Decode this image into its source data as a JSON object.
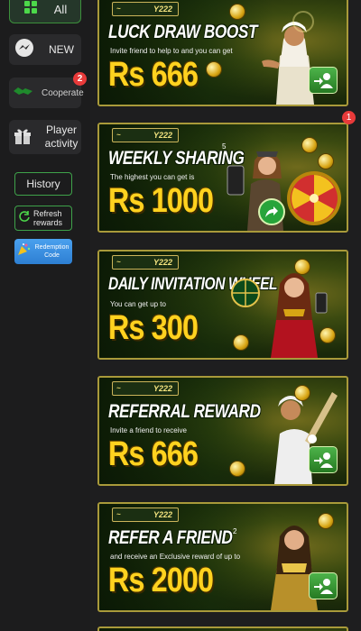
{
  "sidebar": {
    "all_label": "All",
    "new_label": "NEW",
    "cooperate_label": "Cooperate",
    "cooperate_badge": "2",
    "player_activity_label": "Player activity",
    "history_label": "History",
    "refresh_label": "Refresh rewards",
    "redemption_label": "Redemption Code"
  },
  "banners": [
    {
      "logo": "Y222",
      "title": "LUCK DRAW BOOST",
      "subtitle": "Invite friend to help to and you can get",
      "amount": "Rs 666"
    },
    {
      "logo": "Y222",
      "title": "WEEKLY SHARING",
      "subtitle": "The highest you can get is",
      "amount": "Rs 1000",
      "badge": "1",
      "sup": "5"
    },
    {
      "logo": "Y222",
      "title": "DAILY INVITATION WHEEL",
      "subtitle": "You can get up to",
      "amount": "Rs 300"
    },
    {
      "logo": "Y222",
      "title": "REFERRAL REWARD",
      "subtitle": "Invite a friend to receive",
      "amount": "Rs 666"
    },
    {
      "logo": "Y222",
      "title": "REFER A FRIEND",
      "subtitle": "and receive an Exclusive reward of up to",
      "amount": "Rs 2000",
      "sup": "2"
    }
  ],
  "colors": {
    "background": "#1e1e1f",
    "accent_green": "#3ea24a",
    "amount_gold": "#ffd21f",
    "badge_red": "#e83a3a"
  }
}
